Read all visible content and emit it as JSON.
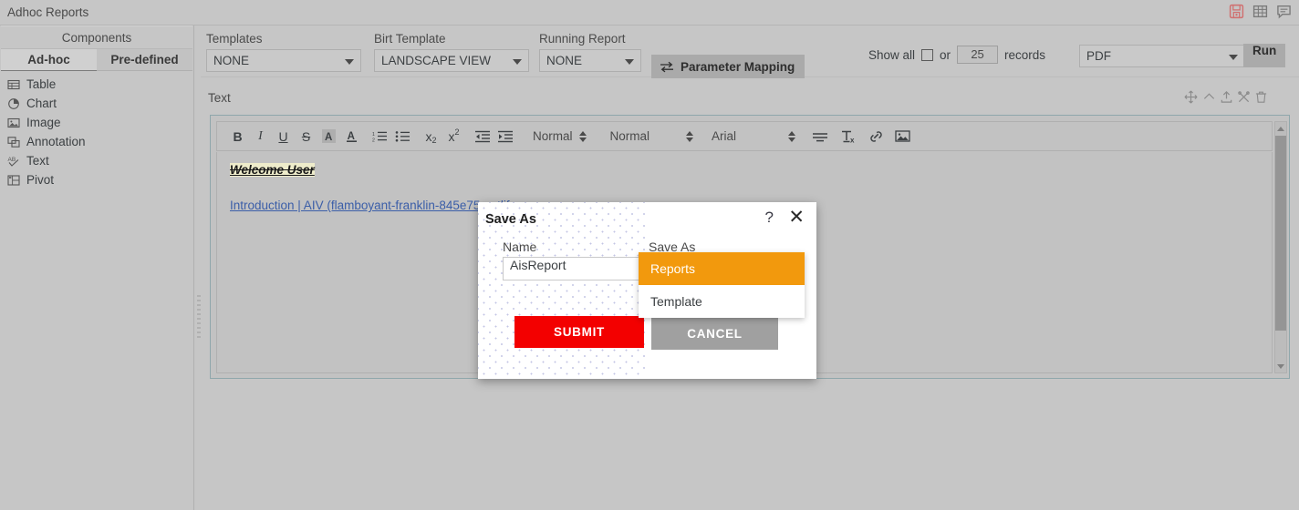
{
  "titlebar": {
    "title": "Adhoc Reports",
    "icons": [
      {
        "name": "save-icon"
      },
      {
        "name": "table-icon"
      },
      {
        "name": "comment-icon"
      }
    ]
  },
  "sidebar": {
    "header": "Components",
    "tabs": [
      {
        "label": "Ad-hoc",
        "active": true
      },
      {
        "label": "Pre-defined",
        "active": false
      }
    ],
    "items": [
      {
        "label": "Table",
        "icon": "table-icon"
      },
      {
        "label": "Chart",
        "icon": "pie-chart-icon"
      },
      {
        "label": "Image",
        "icon": "image-icon"
      },
      {
        "label": "Annotation",
        "icon": "annotation-icon"
      },
      {
        "label": "Text",
        "icon": "text-abc-icon"
      },
      {
        "label": "Pivot",
        "icon": "pivot-icon"
      }
    ]
  },
  "toolbar": {
    "templates": {
      "label": "Templates",
      "value": "NONE"
    },
    "birt_template": {
      "label": "Birt Template",
      "value": "LANDSCAPE VIEW"
    },
    "running_report": {
      "label": "Running Report",
      "value": "NONE"
    },
    "parameter_mapping": "Parameter Mapping",
    "show_all_label": "Show all",
    "or_label": "or",
    "records_value": "25",
    "records_label": "records",
    "format": "PDF",
    "run": "Run"
  },
  "panel": {
    "title": "Text",
    "icons": [
      {
        "name": "move-icon"
      },
      {
        "name": "chevron-up-icon"
      },
      {
        "name": "export-icon"
      },
      {
        "name": "settings-icon"
      },
      {
        "name": "delete-icon"
      }
    ]
  },
  "editor": {
    "toolbar_buttons": [
      {
        "name": "bold-icon",
        "glyph": "B"
      },
      {
        "name": "italic-icon",
        "glyph": "I"
      },
      {
        "name": "underline-icon",
        "glyph": "U"
      },
      {
        "name": "strikethrough-icon",
        "glyph": "S"
      },
      {
        "name": "highlight-color-icon",
        "glyph": "A"
      },
      {
        "name": "font-color-icon",
        "glyph": "A"
      },
      {
        "name": "ordered-list-icon",
        "glyph": "1."
      },
      {
        "name": "unordered-list-icon",
        "glyph": "•"
      },
      {
        "name": "subscript-icon",
        "glyph": "x2"
      },
      {
        "name": "superscript-icon",
        "glyph": "x2"
      },
      {
        "name": "outdent-icon",
        "glyph": "<"
      },
      {
        "name": "indent-icon",
        "glyph": ">"
      }
    ],
    "selects": [
      {
        "name": "heading-select",
        "value": "Normal"
      },
      {
        "name": "line-height-select",
        "value": "Normal"
      },
      {
        "name": "font-family-select",
        "value": "Arial"
      }
    ],
    "trailing_buttons": [
      {
        "name": "align-icon"
      },
      {
        "name": "clear-format-icon"
      },
      {
        "name": "link-icon"
      },
      {
        "name": "insert-image-icon"
      }
    ],
    "content": {
      "heading": "Welcome User",
      "link": "Introduction | AIV (flamboyant-franklin-845e75.netlif"
    }
  },
  "dialog": {
    "title": "Save As",
    "help": "?",
    "close": "✕",
    "name_label": "Name",
    "name_value": "AisReport",
    "saveas_label": "Save As",
    "submit": "SUBMIT",
    "cancel": "CANCEL",
    "options": [
      {
        "label": "Reports",
        "selected": true
      },
      {
        "label": "Template",
        "selected": false
      }
    ]
  },
  "colors": {
    "accent_orange": "#f2990d",
    "submit_red": "#f30000",
    "cancel_gray": "#a0a0a0",
    "chrome_gray": "#c6c6c6",
    "link_blue": "#3b5ea8",
    "highlight_yellow": "#eeeccb"
  }
}
